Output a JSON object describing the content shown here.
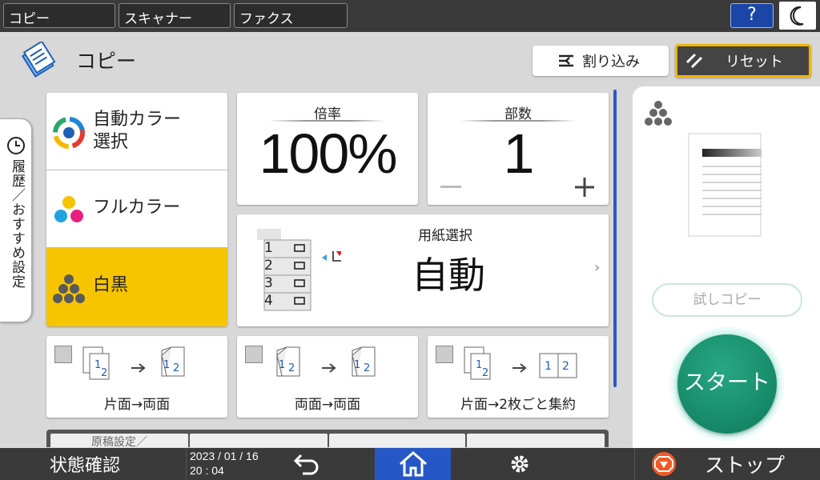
{
  "topbar": {
    "tabs": [
      {
        "label": "コピー"
      },
      {
        "label": "スキャナー"
      },
      {
        "label": "ファクス"
      }
    ],
    "help_label": "?"
  },
  "header": {
    "title": "コピー",
    "interrupt_label": "割り込み",
    "reset_label": "リセット"
  },
  "history_tab": {
    "label": "履歴／おすすめ設定"
  },
  "color_modes": [
    {
      "label": "自動カラー選択",
      "line1": "自動カラー",
      "line2": "選択",
      "selected": false
    },
    {
      "label": "フルカラー",
      "selected": false
    },
    {
      "label": "白黒",
      "selected": true
    }
  ],
  "ratio": {
    "title": "倍率",
    "value": "100%"
  },
  "copies": {
    "title": "部数",
    "value": "1",
    "minus": "−",
    "plus": "+"
  },
  "paper": {
    "title": "用紙選択",
    "value": "自動",
    "trays": [
      "1",
      "2",
      "3",
      "4"
    ],
    "arrow": "›"
  },
  "duplex": [
    {
      "label": "片面→両面",
      "left_num": "1",
      "right_num": "2"
    },
    {
      "label": "両面→両面",
      "left_num": "2",
      "right_num": "2"
    },
    {
      "label": "片面→2枚ごと集約",
      "left_num": "2",
      "right_num": "1 2"
    }
  ],
  "bottom_tabs": [
    {
      "label": "原稿設定／"
    },
    {
      "label": ""
    },
    {
      "label": ""
    },
    {
      "label": ""
    }
  ],
  "right_panel": {
    "sample_copy_label": "試しコピー",
    "start_label": "スタート"
  },
  "statusbar": {
    "status_label": "状態確認",
    "date": "2023 / 01 / 16",
    "time": "20 : 04",
    "stop_label": "ストップ"
  },
  "colors": {
    "accent_yellow": "#f6c500",
    "start_green": "#1a9070",
    "home_blue": "#2657c6",
    "help_blue": "#1b46a8"
  }
}
